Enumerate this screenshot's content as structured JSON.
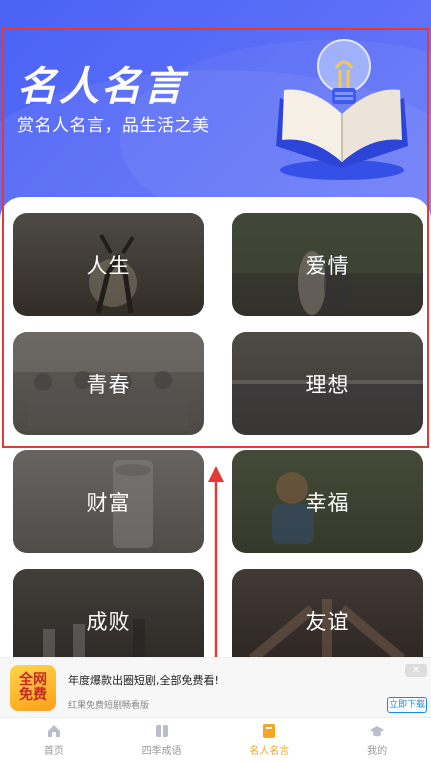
{
  "header": {
    "title": "名人名言",
    "subtitle": "赏名人名言，品生活之美"
  },
  "categories": [
    {
      "label": "人生"
    },
    {
      "label": "爱情"
    },
    {
      "label": "青春"
    },
    {
      "label": "理想"
    },
    {
      "label": "财富"
    },
    {
      "label": "幸福"
    },
    {
      "label": "成败"
    },
    {
      "label": "友谊"
    }
  ],
  "ad": {
    "icon_text_1": "全网",
    "icon_text_2": "免费",
    "title": "年度爆款出圈短剧,全部免费看!",
    "subtitle": "红果免费短剧畅看版",
    "button": "立即下载",
    "close": "✕"
  },
  "tabbar": {
    "items": [
      {
        "label": "首页",
        "icon": "home-icon"
      },
      {
        "label": "四季成语",
        "icon": "book-icon"
      },
      {
        "label": "名人名言",
        "icon": "quote-book-icon"
      },
      {
        "label": "我的",
        "icon": "profile-icon"
      }
    ],
    "active_index": 2
  },
  "colors": {
    "header_blue": "#4a63f5",
    "tab_active": "#f5a623",
    "tab_inactive": "#999999",
    "annotation_red": "#e53935"
  }
}
